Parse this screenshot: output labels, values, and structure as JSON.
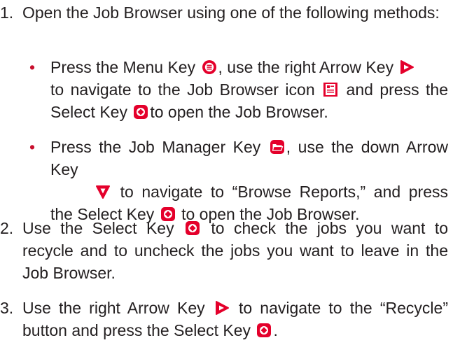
{
  "steps": [
    {
      "number": "1.",
      "text": "Open the Job Browser using one of the following methods:"
    },
    {
      "number": "2.",
      "text_before": "Use the Select Key",
      "text_after": "to check the jobs you want to recycle and to uncheck the jobs you want to leave in the Job Browser."
    },
    {
      "number": "3.",
      "text_a": "Use the right Arrow Key",
      "text_b": "to navigate to the “Recycle” button and press the Select Key",
      "text_c": "."
    }
  ],
  "bullets": [
    {
      "bullet_char": "•",
      "t1": "Press the Menu Key",
      "t2": ", use the right Arrow Key",
      "t3": "to navigate to the Job Browser icon",
      "t4": "and press the Select Key",
      "t5": "to open the Job Browser."
    },
    {
      "bullet_char": "•",
      "t1": "Press the Job Manager Key",
      "t2": ", use the down Arrow Key",
      "t3": "to navigate to “Browse Reports,” and press the Select Key",
      "t4": "to open the Job Browser."
    }
  ],
  "icons": {
    "menu": "menu-key-icon",
    "right_arrow": "right-arrow-key-icon",
    "down_arrow": "down-arrow-key-icon",
    "select": "select-key-icon",
    "job_browser": "job-browser-icon",
    "job_manager": "job-manager-key-icon",
    "accent_color": "#e4002b"
  }
}
